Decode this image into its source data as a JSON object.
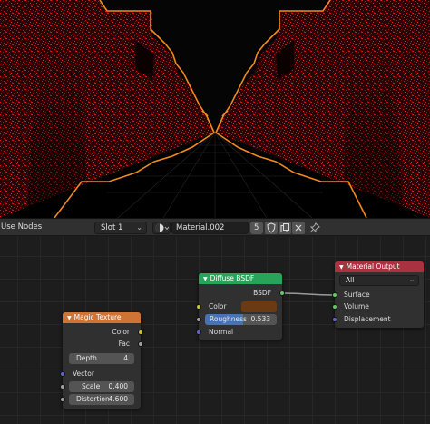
{
  "colors": {
    "viewport_bg": "#050505",
    "noise_red": "#b3130d",
    "outline_orange": "#f28a1c",
    "magic_texture_header": "#cf7434",
    "diffuse_header": "#29a35a",
    "output_header": "#a83240",
    "roughness_fill": "#4772b3",
    "color_swatch": "#6b3a12"
  },
  "header": {
    "use_nodes_label": "Use Nodes",
    "slot_label": "Slot 1",
    "material_name": "Material.002",
    "user_count": "5",
    "icons": [
      "material-sphere-icon",
      "fake-user-shield-icon",
      "duplicate-icon",
      "unlink-x-icon",
      "pin-icon"
    ]
  },
  "nodes": {
    "magic_texture": {
      "title": "Magic Texture",
      "outputs": [
        "Color",
        "Fac"
      ],
      "depth": {
        "label": "Depth",
        "value": "4"
      },
      "vector_label": "Vector",
      "scale": {
        "label": "Scale",
        "value": "0.400"
      },
      "distortion": {
        "label": "Distortion",
        "value": "4.600"
      }
    },
    "diffuse_bsdf": {
      "title": "Diffuse BSDF",
      "output": "BSDF",
      "color_label": "Color",
      "roughness": {
        "label": "Roughness",
        "value": "0.533",
        "fraction": 0.533
      },
      "normal_label": "Normal"
    },
    "material_output": {
      "title": "Material Output",
      "target": "All",
      "inputs": [
        "Surface",
        "Volume",
        "Displacement"
      ]
    }
  }
}
